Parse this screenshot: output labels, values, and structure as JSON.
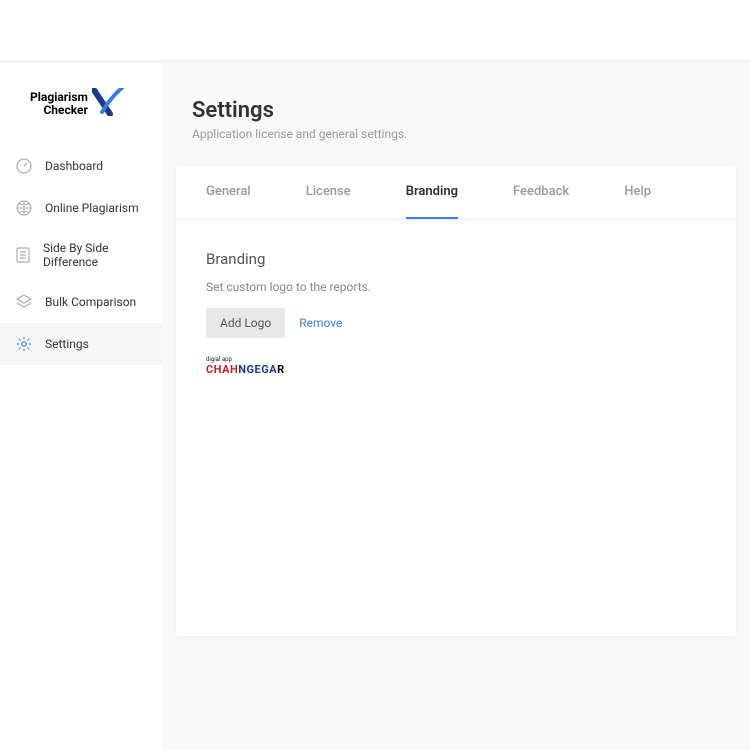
{
  "logo": {
    "line1": "Plagiarism",
    "line2": "Checker"
  },
  "sidebar": {
    "items": [
      {
        "label": "Dashboard"
      },
      {
        "label": "Online Plagiarism"
      },
      {
        "label": "Side By Side Difference"
      },
      {
        "label": "Bulk Comparison"
      },
      {
        "label": "Settings"
      }
    ]
  },
  "page": {
    "title": "Settings",
    "subtitle": "Application license and general settings."
  },
  "tabs": [
    {
      "label": "General"
    },
    {
      "label": "License"
    },
    {
      "label": "Branding"
    },
    {
      "label": "Feedback"
    },
    {
      "label": "Help"
    }
  ],
  "branding": {
    "title": "Branding",
    "desc": "Set custom logo to the reports.",
    "add_button": "Add Logo",
    "remove_link": "Remove",
    "custom_logo_small": "digial app",
    "custom_logo_text": "CHAHNGEGAR"
  }
}
